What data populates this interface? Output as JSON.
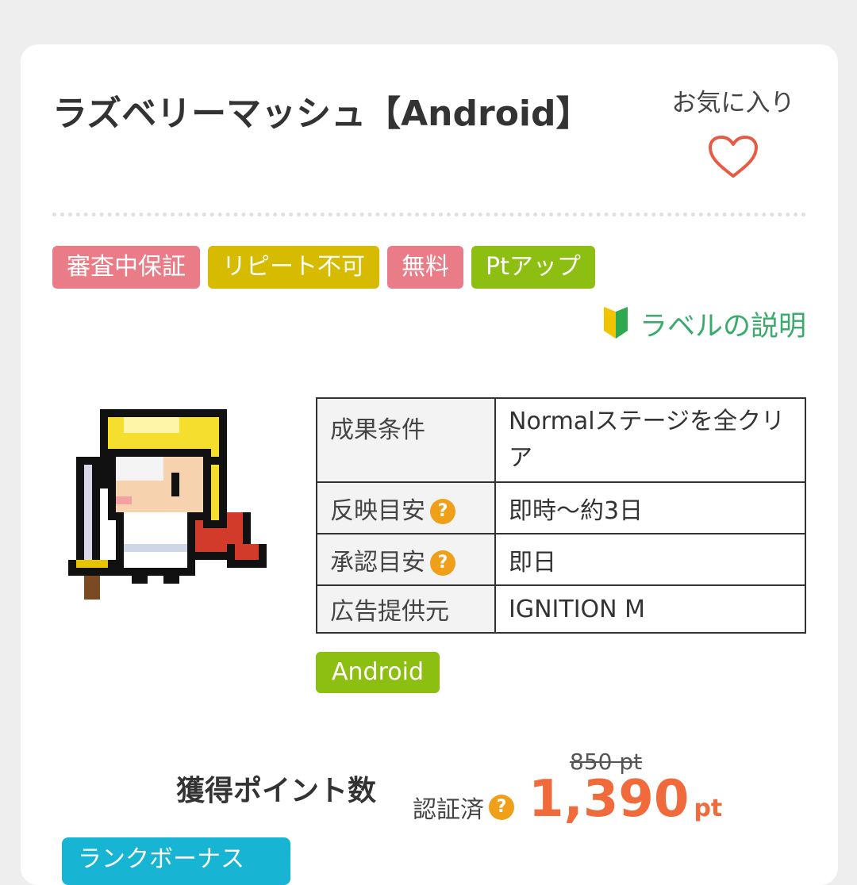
{
  "header": {
    "title": "ラズベリーマッシュ【Android】",
    "favorite_label": "お気に入り",
    "favorite_icon": "heart-outline-icon"
  },
  "labels": [
    {
      "text": "審査中保証",
      "color": "#e97c86"
    },
    {
      "text": "リピート不可",
      "color": "#d6bb00"
    },
    {
      "text": "無料",
      "color": "#e97c86"
    },
    {
      "text": "Ptアップ",
      "color": "#8cbf12"
    }
  ],
  "label_help": {
    "text": "ラベルの説明",
    "icon": "beginner-leaf-icon"
  },
  "info_table": [
    {
      "key": "成果条件",
      "value": "Normalステージを全クリア"
    },
    {
      "key": "反映目安",
      "value": "即時〜約3日"
    },
    {
      "key": "承認目安",
      "value": "即日"
    },
    {
      "key": "広告提供元",
      "value": "IGNITION M"
    }
  ],
  "os_badge": "Android",
  "points": {
    "label": "獲得ポイント数",
    "verified_label": "認証済",
    "old_value": "850 pt",
    "value": "1,390",
    "unit": "pt"
  },
  "rank_badge": "ランクボーナス",
  "colors": {
    "accent": "#f06a3b",
    "help_green": "#3aab6d",
    "question": "#f0a018",
    "rank": "#17b4d4"
  }
}
